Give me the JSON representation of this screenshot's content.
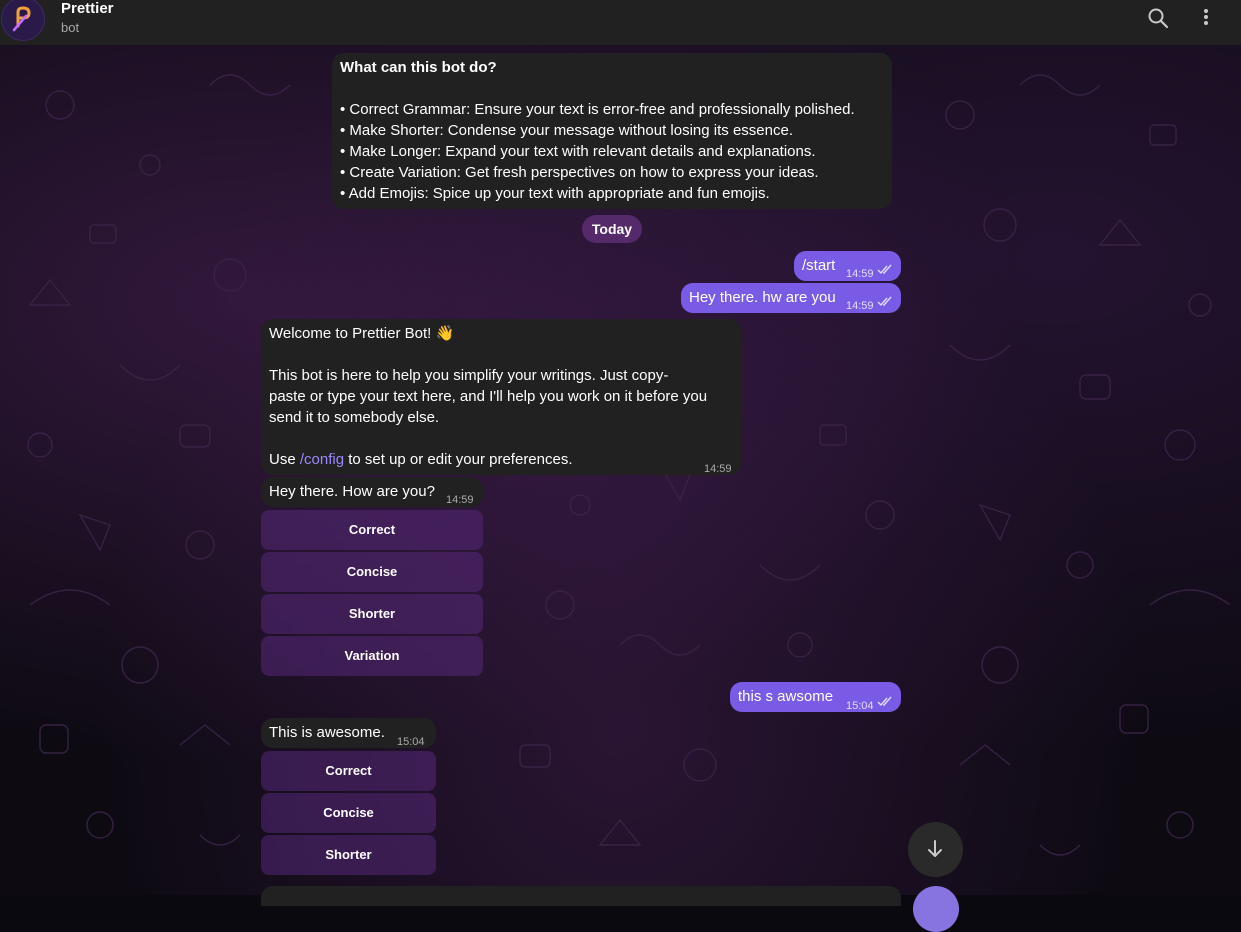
{
  "header": {
    "title": "Prettier",
    "status": "bot",
    "icons": [
      "search-icon",
      "more-vertical-icon"
    ]
  },
  "intro": {
    "heading": "What can this bot do?",
    "items": [
      "• Correct Grammar: Ensure your text is error-free and professionally polished.",
      "• Make Shorter: Condense your message without losing its essence.",
      "• Make Longer: Expand your text with relevant details and explanations.",
      "• Create Variation: Get fresh perspectives on how to express your ideas.",
      "• Add Emojis: Spice up your text with appropriate and fun emojis."
    ]
  },
  "date_separator": "Today",
  "messages": {
    "m1": {
      "text": "/start",
      "time": "14:59"
    },
    "m2": {
      "text": "Hey there. hw are you",
      "time": "14:59"
    },
    "m3": {
      "line1": "Welcome to Prettier Bot! 👋",
      "para_lines": [
        "This bot is here to help you simplify your writings. Just copy-",
        "paste or type your text here, and I'll help you work on it before you",
        "send it to somebody else."
      ],
      "use_prefix": "Use ",
      "use_link": "/config",
      "use_suffix": " to set up or edit your preferences.",
      "time": "14:59"
    },
    "m4": {
      "text": "Hey there. How are you?",
      "time": "14:59"
    },
    "m5": {
      "text": "this s awsome",
      "time": "15:04"
    },
    "m6": {
      "text": "This is awesome.",
      "time": "15:04"
    }
  },
  "keyboard1": [
    "Correct",
    "Concise",
    "Shorter",
    "Variation"
  ],
  "keyboard2": [
    "Correct",
    "Concise",
    "Shorter"
  ],
  "colors": {
    "outgoing": "#7a5be6",
    "incoming": "#212121",
    "header": "#212121",
    "link": "#9a88ff"
  }
}
